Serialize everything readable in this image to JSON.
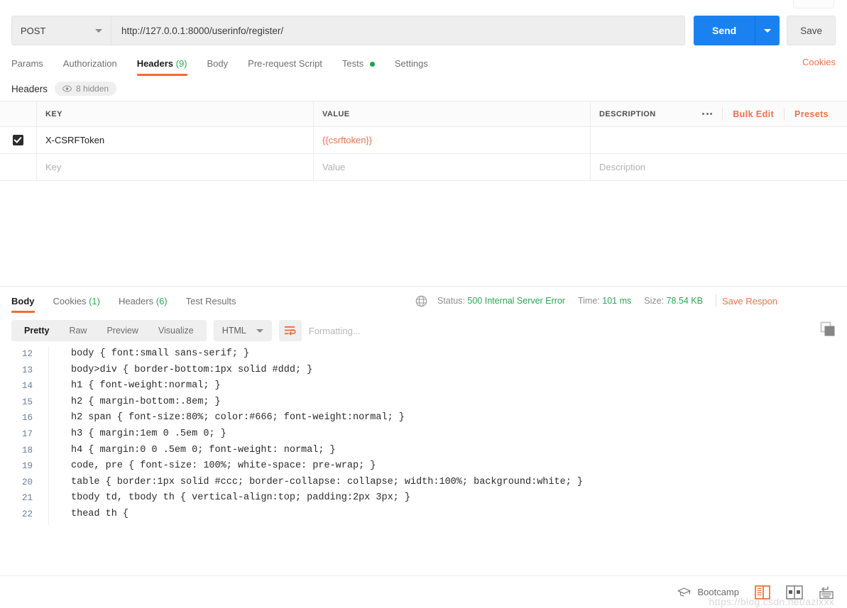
{
  "request": {
    "method": "POST",
    "url": "http://127.0.0.1:8000/userinfo/register/",
    "send_label": "Send",
    "save_label": "Save",
    "cookies_label": "Cookies",
    "tabs": [
      {
        "label": "Params",
        "count": "",
        "active": false
      },
      {
        "label": "Authorization",
        "count": "",
        "active": false
      },
      {
        "label": "Headers",
        "count": "(9)",
        "active": true
      },
      {
        "label": "Body",
        "count": "",
        "active": false
      },
      {
        "label": "Pre-request Script",
        "count": "",
        "active": false
      },
      {
        "label": "Tests",
        "count": "",
        "active": false,
        "dot": true
      },
      {
        "label": "Settings",
        "count": "",
        "active": false
      }
    ]
  },
  "headers_section": {
    "title": "Headers",
    "hidden_label": "8 hidden",
    "columns": {
      "key": "KEY",
      "value": "VALUE",
      "description": "DESCRIPTION"
    },
    "actions": {
      "bulk_edit": "Bulk Edit",
      "presets": "Presets"
    },
    "rows": [
      {
        "checked": true,
        "key": "X-CSRFToken",
        "value": "{{csrftoken}}",
        "description": ""
      }
    ],
    "new_row_placeholders": {
      "key": "Key",
      "value": "Value",
      "description": "Description"
    }
  },
  "response": {
    "tabs": [
      {
        "label": "Body",
        "count": "",
        "active": true
      },
      {
        "label": "Cookies",
        "count": "(1)",
        "active": false
      },
      {
        "label": "Headers",
        "count": "(6)",
        "active": false
      },
      {
        "label": "Test Results",
        "count": "",
        "active": false
      }
    ],
    "status_label": "Status:",
    "status_value": "500 Internal Server Error",
    "time_label": "Time:",
    "time_value": "101 ms",
    "size_label": "Size:",
    "size_value": "78.54 KB",
    "save_response": "Save Respon",
    "format_tabs": [
      {
        "label": "Pretty",
        "active": true
      },
      {
        "label": "Raw",
        "active": false
      },
      {
        "label": "Preview",
        "active": false
      },
      {
        "label": "Visualize",
        "active": false
      }
    ],
    "language": "HTML",
    "formatting_text": "Formatting...",
    "code_lines": [
      {
        "num": "12",
        "text": "body { font:small sans-serif; }"
      },
      {
        "num": "13",
        "text": "body>div { border-bottom:1px solid #ddd; }"
      },
      {
        "num": "14",
        "text": "h1 { font-weight:normal; }"
      },
      {
        "num": "15",
        "text": "h2 { margin-bottom:.8em; }"
      },
      {
        "num": "16",
        "text": "h2 span { font-size:80%; color:#666; font-weight:normal; }"
      },
      {
        "num": "17",
        "text": "h3 { margin:1em 0 .5em 0; }"
      },
      {
        "num": "18",
        "text": "h4 { margin:0 0 .5em 0; font-weight: normal; }"
      },
      {
        "num": "19",
        "text": "code, pre { font-size: 100%; white-space: pre-wrap; }"
      },
      {
        "num": "20",
        "text": "table { border:1px solid #ccc; border-collapse: collapse; width:100%; background:white; }"
      },
      {
        "num": "21",
        "text": "tbody td, tbody th { vertical-align:top; padding:2px 3px; }"
      },
      {
        "num": "22",
        "text": "thead th {"
      }
    ]
  },
  "status_bar": {
    "bootcamp_label": "Bootcamp",
    "watermark": "https://blog.csdn.net/azlxxx"
  },
  "colors": {
    "accent_orange": "#ef6c34",
    "link_orange": "#f0714a",
    "send_blue": "#1a82f0",
    "status_green": "#2aa653",
    "count_green": "#2eaa54"
  }
}
